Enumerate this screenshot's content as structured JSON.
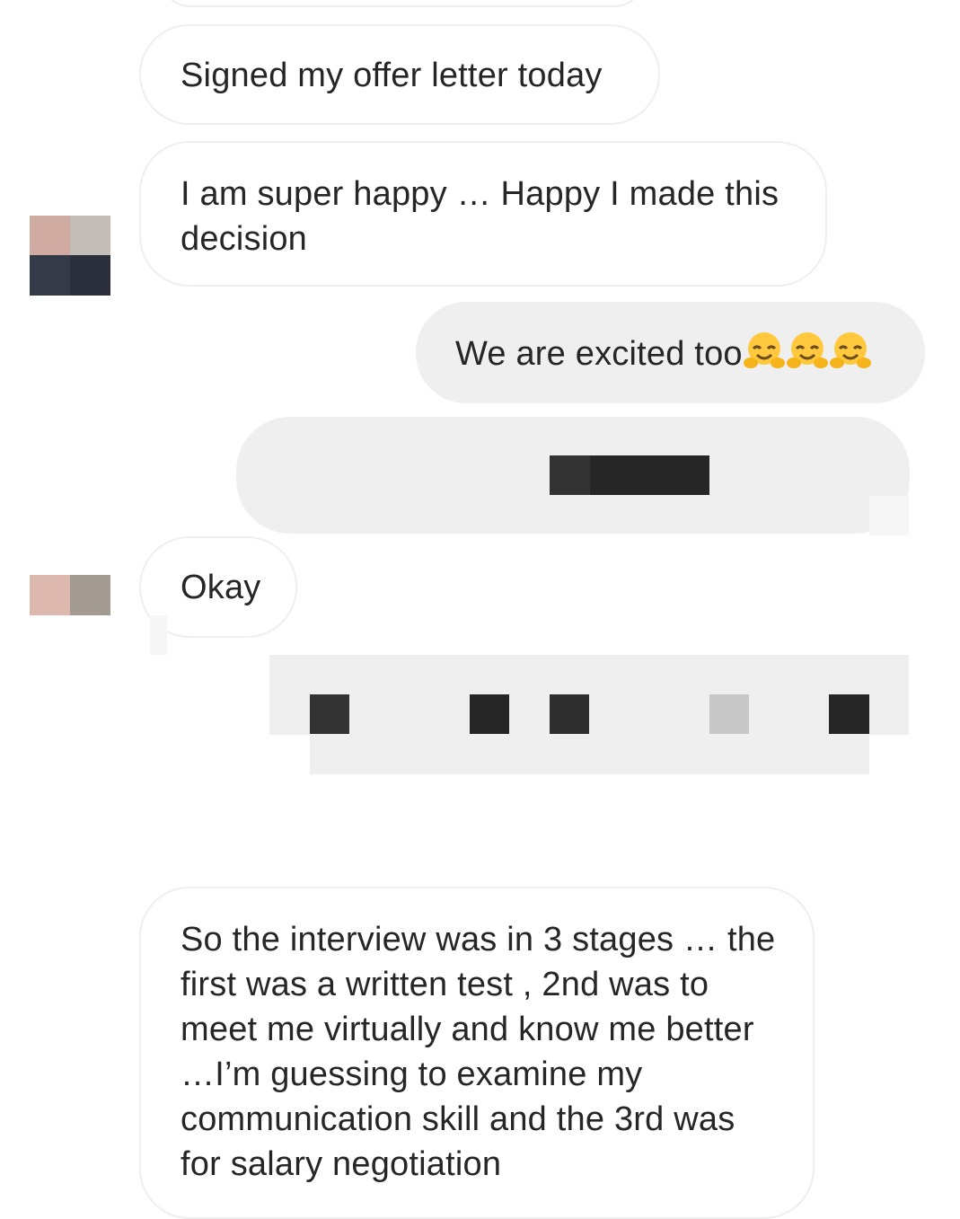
{
  "thread": {
    "messages": [
      {
        "id": "m1",
        "sender": "other",
        "text": "Signed my offer letter today"
      },
      {
        "id": "m2",
        "sender": "other",
        "text": "I am super happy … Happy I made this decision"
      },
      {
        "id": "m3",
        "sender": "me",
        "text": "We are excited too",
        "emoji": [
          "hugging-face",
          "hugging-face",
          "hugging-face"
        ]
      },
      {
        "id": "m4",
        "sender": "me",
        "text": "",
        "redacted": true
      },
      {
        "id": "m5",
        "sender": "other",
        "text": "Okay"
      },
      {
        "id": "m6",
        "sender": "me",
        "text": "",
        "redacted": true
      },
      {
        "id": "m7",
        "sender": "other",
        "text": "So the interview was in 3 stages … the first was a written test , 2nd was to meet me virtually and know me better …I’m guessing to examine my communication skill and the 3rd was for salary negotiation"
      }
    ]
  },
  "colors": {
    "sent_bubble": "#efefef",
    "received_border": "#efefef",
    "text": "#262626",
    "emoji_face": "#ffc83d"
  }
}
